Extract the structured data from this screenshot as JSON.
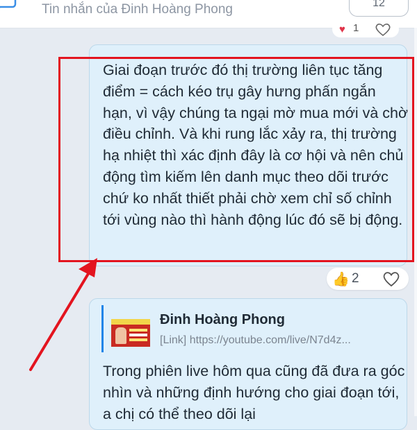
{
  "header": {
    "title": "Tin nhắn của Đinh Hoàng Phong",
    "count_label": "12"
  },
  "previous_message": {
    "reaction_count": "1"
  },
  "message": {
    "text": "Giai đoạn trước đó thị trường liên tục tăng điểm = cách kéo trụ gây hưng phấn ngắn hạn, vì vậy chúng ta ngại mờ mua mới và chờ điều chỉnh. Và khi rung lắc xảy ra, thị trường hạ nhiệt thì xác định đây là cơ hội và nên chủ động tìm kiếm lên danh mục theo dõi trước chứ ko nhất thiết phải chờ xem chỉ số chỉnh tới vùng nào thì hành động lúc đó sẽ bị động.",
    "reaction_count": "2"
  },
  "link_message": {
    "sender_name": "Đinh Hoàng Phong",
    "link_text": "[Link] https://youtube.com/live/N7d4z...",
    "text": "Trong phiên live hôm qua cũng đã đưa ra góc nhìn và những định hướng cho giai đoạn tới, a chị có thể theo dõi lại"
  },
  "colors": {
    "highlight": "#e3141f",
    "bubble": "#dff0fb",
    "accent": "#1d85e8"
  },
  "icons": {
    "header": "chat-bubble-icon",
    "like": "thumbs-up-icon",
    "heart": "heart-outline-icon"
  }
}
